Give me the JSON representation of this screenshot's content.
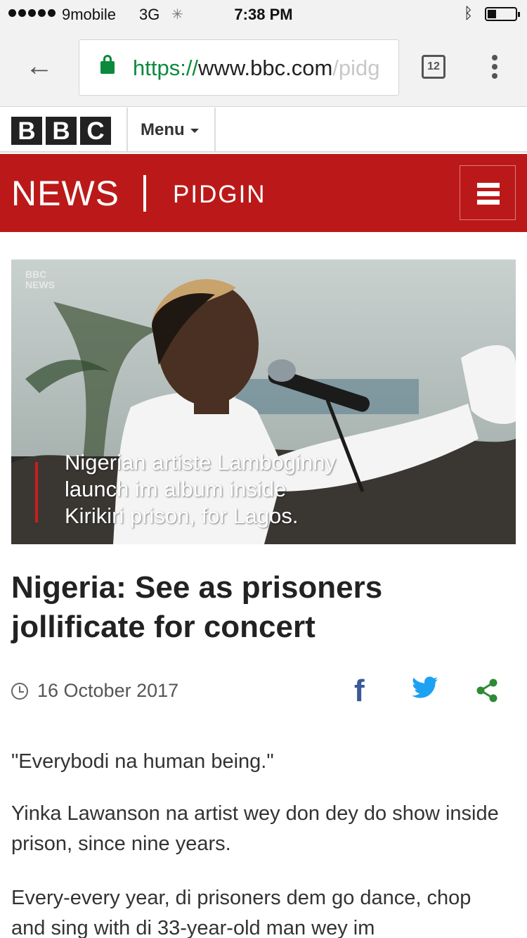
{
  "status_bar": {
    "carrier": "9mobile",
    "network": "3G",
    "time": "7:38 PM"
  },
  "browser": {
    "url_scheme": "https://",
    "url_host": "www.bbc.com",
    "url_path": "/pidg",
    "tab_count": "12"
  },
  "bbc_header": {
    "logo_letters": [
      "B",
      "B",
      "C"
    ],
    "menu_label": "Menu"
  },
  "news_header": {
    "news_label": "NEWS",
    "section_label": "PIDGIN"
  },
  "hero": {
    "watermark": [
      "BBC",
      "NEWS"
    ],
    "caption_lines": [
      "Nigerian artiste Lamboginny",
      "launch im album inside",
      "Kirikiri prison, for Lagos."
    ]
  },
  "article": {
    "headline": "Nigeria: See as prisoners jollificate for concert",
    "date": "16 October 2017",
    "paragraphs": [
      "\"Everybodi na human being.\"",
      "Yinka Lawanson na artist wey don dey do show inside prison, since nine years.",
      "Every-every year, di prisoners dem go dance, chop and sing with di 33-year-old man wey im"
    ]
  },
  "colors": {
    "brand_red": "#bb1919",
    "secure_green": "#0b8a3e",
    "facebook_blue": "#3b5998",
    "twitter_blue": "#1da1f2",
    "share_green": "#2e8b35"
  },
  "icons": {
    "back": "arrow-left",
    "lock": "lock",
    "tabs": "tab-switcher",
    "more": "vertical-dots",
    "menu_caret": "caret-down",
    "hamburger": "hamburger",
    "clock": "clock",
    "facebook": "facebook-f",
    "twitter": "twitter-bird",
    "share": "share-nodes"
  }
}
